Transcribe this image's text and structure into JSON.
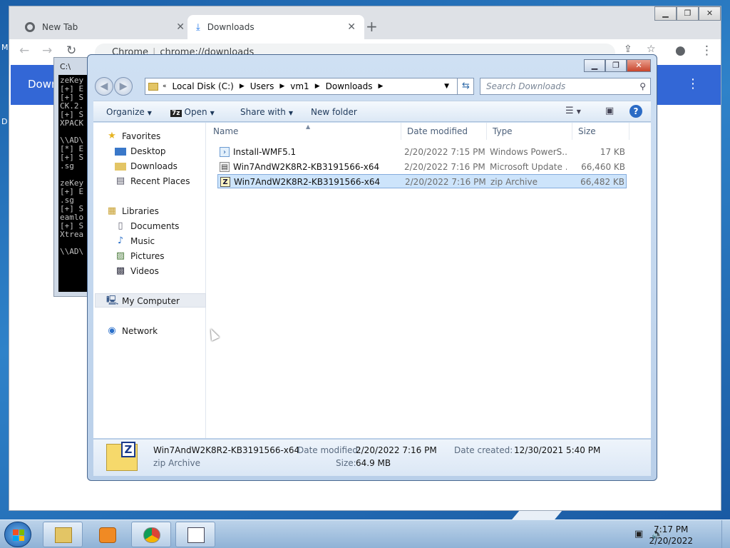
{
  "chrome": {
    "tabs": [
      {
        "title": "New Tab",
        "icon": "chrome-icon"
      },
      {
        "title": "Downloads",
        "icon": "download-icon"
      }
    ],
    "omnibox_site": "Chrome",
    "omnibox_url": "chrome://downloads",
    "banner_title": "Downl"
  },
  "desktop": {
    "left_char_1": "M",
    "left_char_2": "D"
  },
  "cmd": {
    "title": "C:\\",
    "lines": "zeKey\n[+] E\n[+] S\nCK.2.\n[+] S\nXPACK\n\n\\\\AD\\\n[*] E\n[+] S\n.sg\n\nzeKey\n[+] E\n.sg\n[+] S\neamlo\n[+] S\nXtrea\n\n\\\\AD\\"
  },
  "explorer": {
    "breadcrumbs": [
      "Local Disk (C:)",
      "Users",
      "vm1",
      "Downloads"
    ],
    "search_placeholder": "Search Downloads",
    "commands": {
      "organize": "Organize",
      "open": "Open",
      "open_tag": "7z",
      "share": "Share with",
      "new_folder": "New folder"
    },
    "nav": {
      "favorites": "Favorites",
      "desktop": "Desktop",
      "downloads": "Downloads",
      "recent": "Recent Places",
      "libraries": "Libraries",
      "documents": "Documents",
      "music": "Music",
      "pictures": "Pictures",
      "videos": "Videos",
      "my_computer": "My Computer",
      "network": "Network"
    },
    "columns": {
      "name": "Name",
      "date": "Date modified",
      "type": "Type",
      "size": "Size"
    },
    "files": [
      {
        "name": "Install-WMF5.1",
        "date": "2/20/2022 7:15 PM",
        "type": "Windows PowerS...",
        "size": "17 KB",
        "icon": "powershell-script-icon"
      },
      {
        "name": "Win7AndW2K8R2-KB3191566-x64",
        "date": "2/20/2022 7:16 PM",
        "type": "Microsoft Update ...",
        "size": "66,460 KB",
        "icon": "msu-file-icon"
      },
      {
        "name": "Win7AndW2K8R2-KB3191566-x64",
        "date": "2/20/2022 7:16 PM",
        "type": "zip Archive",
        "size": "66,482 KB",
        "icon": "zip-file-icon"
      }
    ],
    "details": {
      "name": "Win7AndW2K8R2-KB3191566-x64",
      "type": "zip Archive",
      "modified_label": "Date modified:",
      "modified": "2/20/2022 7:16 PM",
      "size_label": "Size:",
      "size": "64.9 MB",
      "created_label": "Date created:",
      "created": "12/30/2021 5:40 PM"
    }
  },
  "taskbar": {
    "time": "7:17 PM",
    "date": "2/20/2022"
  },
  "colors": {
    "chrome_banner": "#3367d6",
    "selection": "#cde4fb",
    "taskbar": "#8fb2d6"
  }
}
